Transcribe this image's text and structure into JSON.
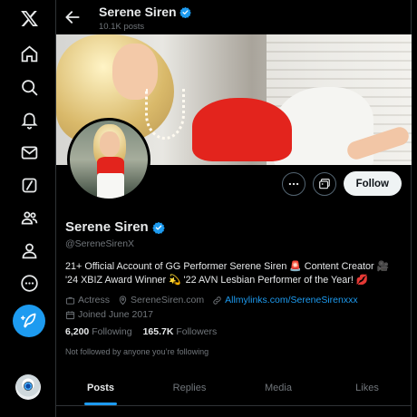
{
  "nav": {
    "items": [
      {
        "name": "x-logo-icon"
      },
      {
        "name": "home-icon"
      },
      {
        "name": "explore-icon"
      },
      {
        "name": "notifications-icon"
      },
      {
        "name": "messages-icon"
      },
      {
        "name": "grok-icon"
      },
      {
        "name": "communities-icon"
      },
      {
        "name": "profile-icon"
      },
      {
        "name": "more-icon"
      }
    ],
    "compose_icon": "compose-feather-icon"
  },
  "header": {
    "display_name": "Serene Siren",
    "post_count": "10.1K posts"
  },
  "profile": {
    "display_name": "Serene Siren",
    "handle": "@SereneSirenX",
    "bio": "21+ Official Account of GG Performer Serene Siren 🚨 Content Creator 🎥 '24 XBIZ Award Winner 💫 '22 AVN Lesbian Performer of the Year! 💋",
    "category": "Actress",
    "location": "SereneSiren.com",
    "link": "Allmylinks.com/SereneSirenxxx",
    "joined": "Joined June 2017",
    "following_count": "6,200",
    "following_label": "Following",
    "followers_count": "165.7K",
    "followers_label": "Followers",
    "not_followed_note": "Not followed by anyone you’re following"
  },
  "actions": {
    "follow_label": "Follow"
  },
  "tabs": [
    {
      "label": "Posts",
      "active": true
    },
    {
      "label": "Replies",
      "active": false
    },
    {
      "label": "Media",
      "active": false
    },
    {
      "label": "Likes",
      "active": false
    }
  ],
  "colors": {
    "accent": "#1d9bf0",
    "background": "#000000",
    "muted": "#71767b"
  }
}
